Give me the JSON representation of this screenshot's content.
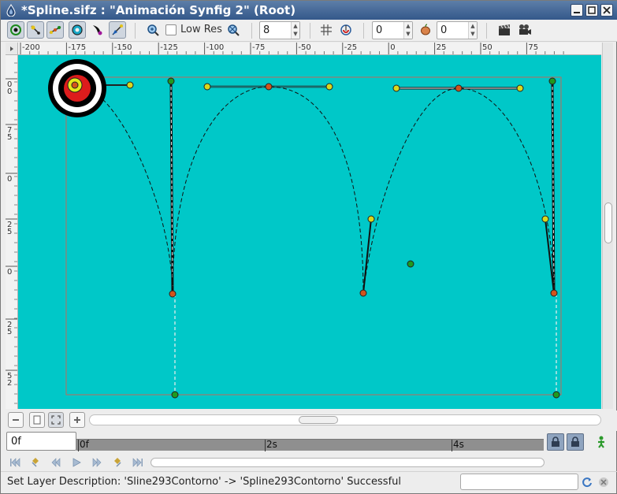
{
  "window": {
    "title": "*Spline.sifz : \"Animación Synfig 2\" (Root)"
  },
  "toolbar": {
    "low_res_label": "Low Res",
    "low_res_checked": false,
    "spin_a_value": "8",
    "spin_b_value": "0",
    "spin_c_value": "0"
  },
  "ruler_top": {
    "ticks": [
      "-200",
      "-175",
      "-150",
      "-125",
      "-100",
      "-75",
      "-50",
      "-25",
      "0",
      "25",
      "50",
      "75"
    ]
  },
  "ruler_left": {
    "ticks": [
      "0 0",
      "7 5",
      "0",
      "2 5",
      "0",
      "2 5",
      "5 2"
    ]
  },
  "timeline": {
    "current_time": "0f",
    "labels": [
      "0f",
      "2s",
      "4s"
    ]
  },
  "status": {
    "message": "Set Layer Description: 'Sline293Contorno' -> 'Spline293Contorno' Successful"
  },
  "colors": {
    "canvas_bg": "#00c8c8",
    "title_bar": "#34588a",
    "vertex_orange": "#d2541c",
    "tangent_yellow": "#d8d81c",
    "width_green": "#1f9a1f",
    "origin_red": "#dd1c1c"
  },
  "icons": {
    "app": "synfig-drop-icon",
    "transform_tool": "transform-tool-icon",
    "smooth_move": "smooth-move-icon",
    "scale": "scale-icon",
    "rotate": "rotate-icon",
    "mirror": "mirror-icon",
    "draw": "draw-icon",
    "zoom_in": "zoom-in-icon",
    "zoom_out": "zoom-out-icon",
    "grid": "grid-icon",
    "onion_skin": "onion-skin-icon",
    "render": "render-clapper-icon",
    "preview": "preview-camera-icon"
  }
}
